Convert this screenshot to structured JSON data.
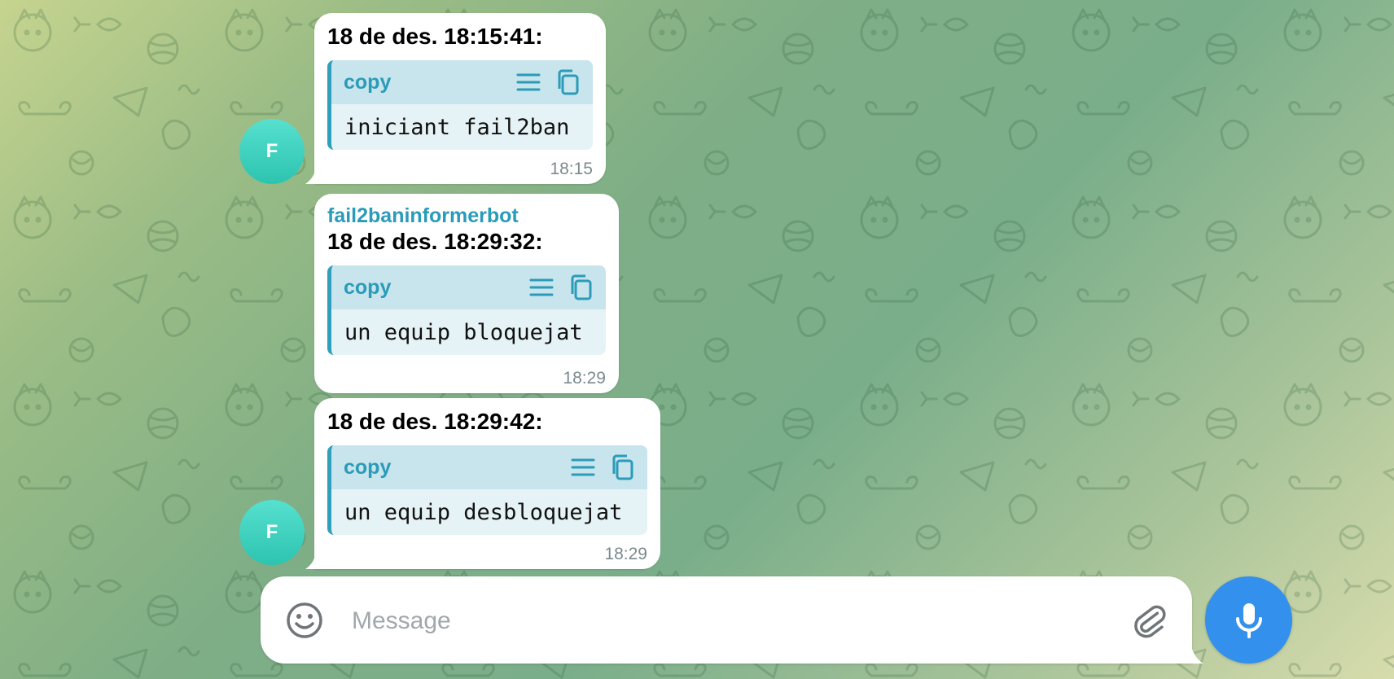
{
  "messages": [
    {
      "heading": "18 de des. 18:15:41:",
      "code_lang": "copy",
      "code_text": "iniciant fail2ban",
      "time": "18:15",
      "avatar_initial": "F"
    },
    {
      "sender": "fail2baninformerbot",
      "heading": "18 de des. 18:29:32:",
      "code_lang": "copy",
      "code_text": "un equip bloquejat",
      "time": "18:29"
    },
    {
      "heading": "18 de des. 18:29:42:",
      "code_lang": "copy",
      "code_text": "un equip desbloquejat",
      "time": "18:29",
      "avatar_initial": "F"
    }
  ],
  "composer": {
    "placeholder": "Message"
  },
  "icons": {
    "emoji": "smiley-icon",
    "attach": "paperclip-icon",
    "mic": "microphone-icon",
    "code_menu": "wrap-lines-icon",
    "code_copy": "copy-icon"
  },
  "colors": {
    "accent": "#3390ec",
    "code_accent": "#2f9fbc",
    "avatar": "#2cc4b0"
  }
}
